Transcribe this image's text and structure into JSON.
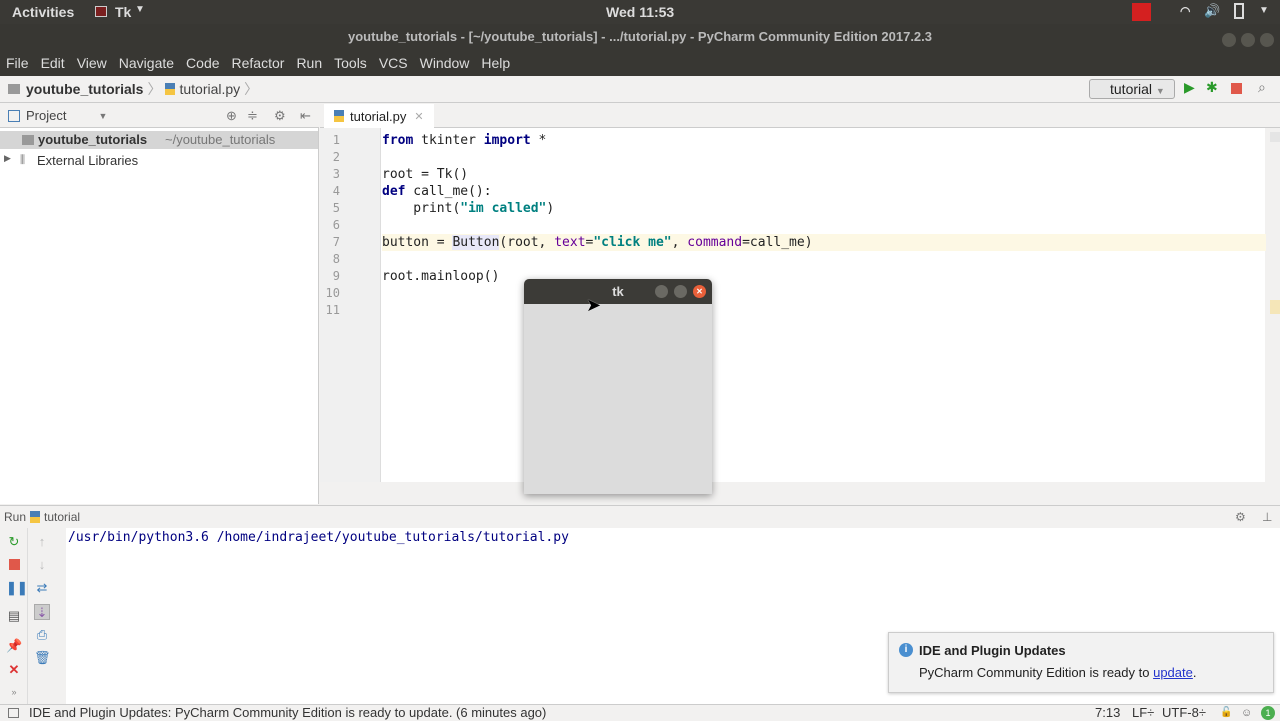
{
  "topbar": {
    "activities": "Activities",
    "app": "Tk",
    "clock": "Wed 11:53"
  },
  "window_title": "youtube_tutorials - [~/youtube_tutorials] - .../tutorial.py - PyCharm Community Edition 2017.2.3",
  "menu": [
    "File",
    "Edit",
    "View",
    "Navigate",
    "Code",
    "Refactor",
    "Run",
    "Tools",
    "VCS",
    "Window",
    "Help"
  ],
  "breadcrumb": {
    "project": "youtube_tutorials",
    "file": "tutorial.py"
  },
  "run_config": "tutorial",
  "project_panel": {
    "title": "Project",
    "root": "youtube_tutorials",
    "root_path": "~/youtube_tutorials",
    "external": "External Libraries"
  },
  "editor": {
    "tab": "tutorial.py",
    "current_line": 7,
    "lines": [
      [
        {
          "t": "from",
          "c": "kw"
        },
        {
          "t": " tkinter ",
          "c": ""
        },
        {
          "t": "import",
          "c": "kw"
        },
        {
          "t": " *",
          "c": ""
        }
      ],
      [],
      [
        {
          "t": "root = Tk()",
          "c": ""
        }
      ],
      [
        {
          "t": "def",
          "c": "kw"
        },
        {
          "t": " call_me():",
          "c": ""
        }
      ],
      [
        {
          "t": "    print(",
          "c": ""
        },
        {
          "t": "\"im called\"",
          "c": "str"
        },
        {
          "t": ")",
          "c": ""
        }
      ],
      [],
      [
        {
          "t": "button = ",
          "c": ""
        },
        {
          "t": "Button",
          "c": "hl"
        },
        {
          "t": "(root, ",
          "c": ""
        },
        {
          "t": "text",
          "c": "param"
        },
        {
          "t": "=",
          "c": ""
        },
        {
          "t": "\"click me\"",
          "c": "str"
        },
        {
          "t": ", ",
          "c": ""
        },
        {
          "t": "command",
          "c": "param"
        },
        {
          "t": "=call_me)",
          "c": ""
        }
      ],
      [],
      [
        {
          "t": "root.mainloop()",
          "c": ""
        }
      ],
      [],
      []
    ]
  },
  "run": {
    "label": "Run",
    "config": "tutorial",
    "output": "/usr/bin/python3.6 /home/indrajeet/youtube_tutorials/tutorial.py"
  },
  "tk_window": {
    "title": "tk"
  },
  "notification": {
    "title": "IDE and Plugin Updates",
    "text": "PyCharm Community Edition is ready to ",
    "link": "update",
    "end": "."
  },
  "status": {
    "message": "IDE and Plugin Updates: PyCharm Community Edition is ready to update. (6 minutes ago)",
    "position": "7:13",
    "line_sep": "LF÷",
    "encoding": "UTF-8÷",
    "event_count": "1"
  }
}
